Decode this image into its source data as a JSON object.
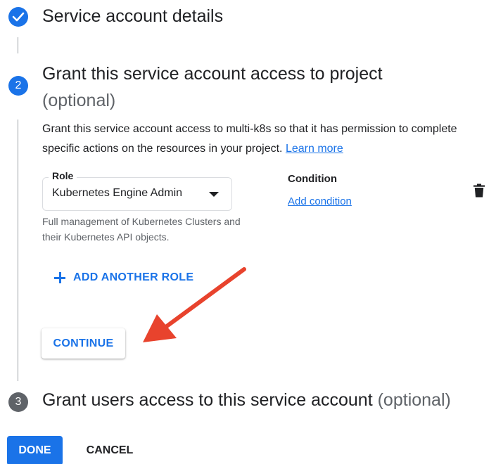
{
  "steps": [
    {
      "number": "",
      "title": "Service account details",
      "state": "completed",
      "icon": "check-icon"
    },
    {
      "number": "2",
      "title": "Grant this service account access to project",
      "optional": "(optional)",
      "state": "active"
    },
    {
      "number": "3",
      "title": "Grant users access to this service account",
      "optional": "(optional)",
      "state": "pending"
    }
  ],
  "step2": {
    "description": "Grant this service account access to multi-k8s so that it has permission to complete specific actions on the resources in your project.",
    "learn_more": "Learn more",
    "role": {
      "label": "Role",
      "value": "Kubernetes Engine Admin",
      "help": "Full management of Kubernetes Clusters and their Kubernetes API objects."
    },
    "condition": {
      "title": "Condition",
      "add_label": "Add condition"
    },
    "delete_icon": "trash-icon",
    "add_role_label": "ADD ANOTHER ROLE",
    "continue_label": "CONTINUE"
  },
  "footer": {
    "done_label": "DONE",
    "cancel_label": "CANCEL"
  },
  "colors": {
    "primary": "#1a73e8",
    "annotation_arrow": "#e8432d",
    "pending_step": "#5f6368",
    "text": "#202124",
    "secondary_text": "#5f6368"
  }
}
